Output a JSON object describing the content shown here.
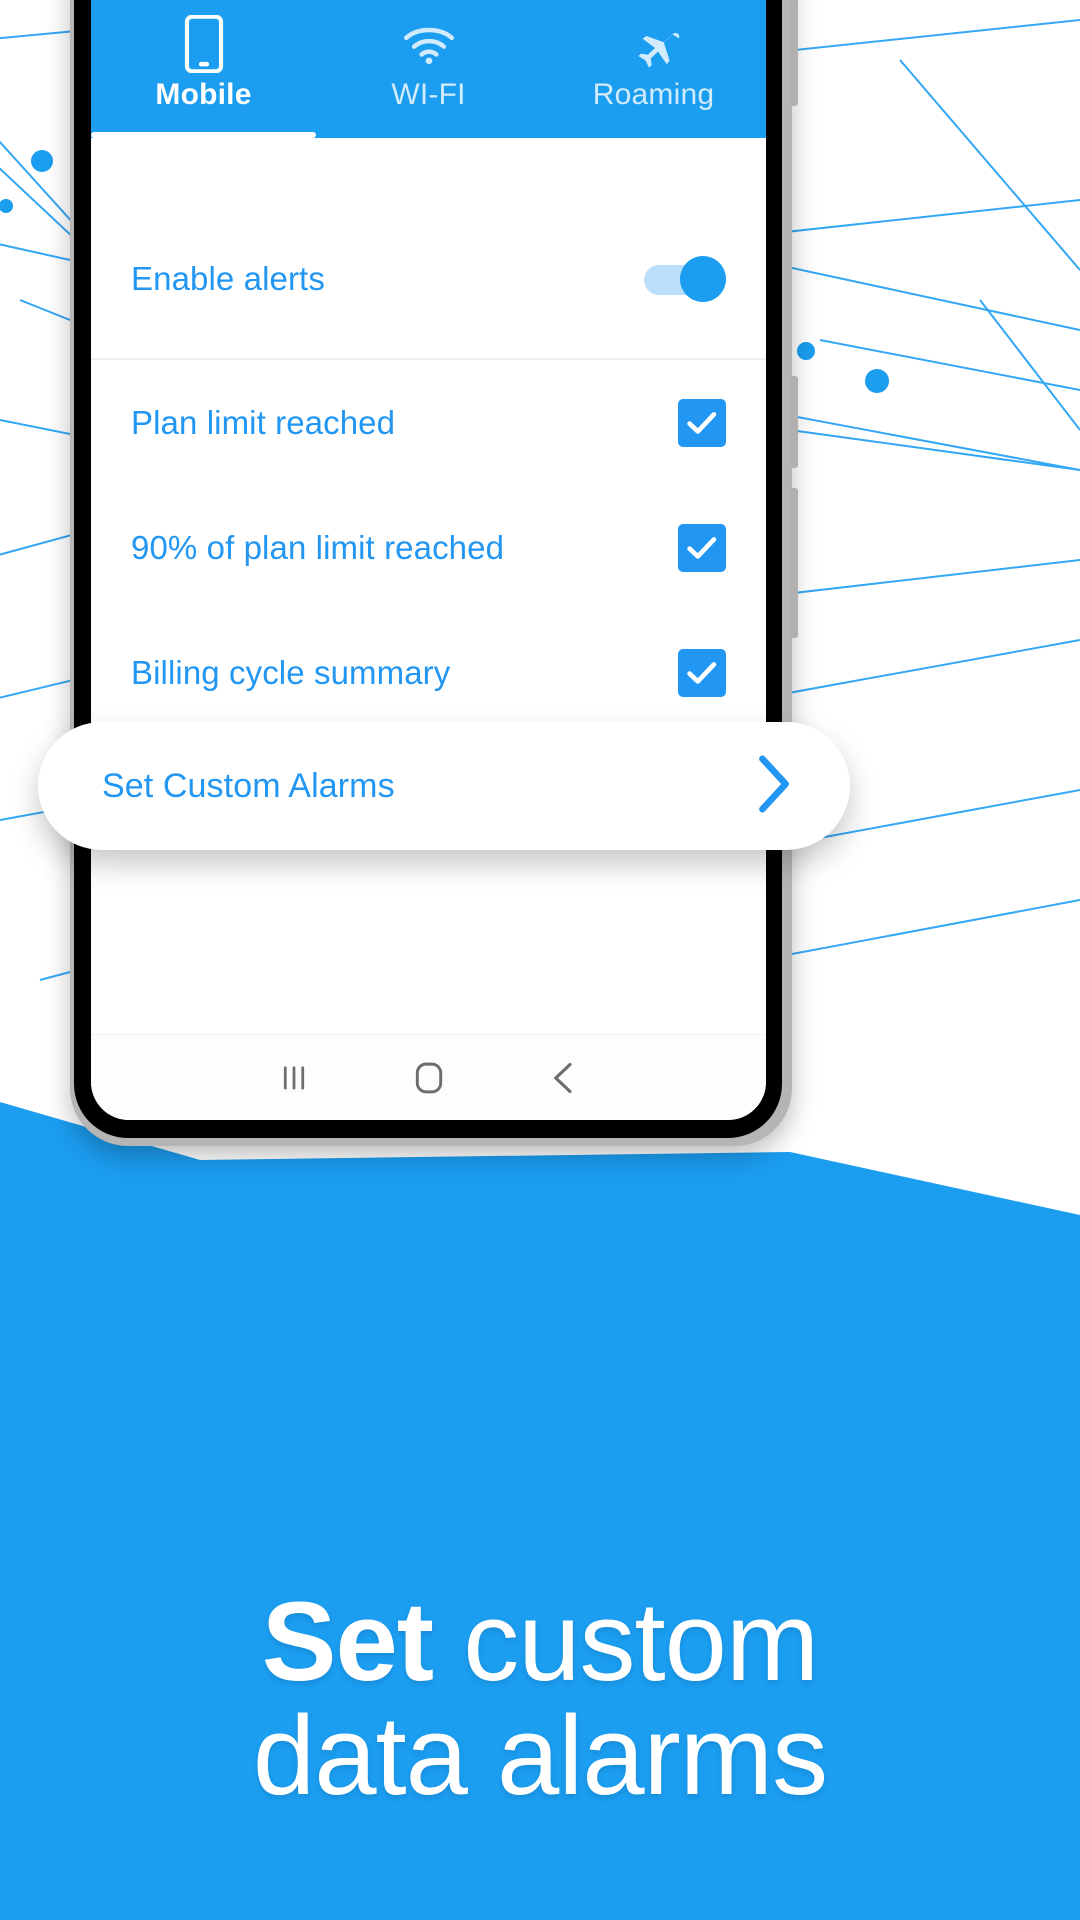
{
  "colors": {
    "brand_blue": "#1b9df0",
    "accent_blue": "#2196f3",
    "toggle_track": "#b9dffb",
    "headline_white": "#ffffff",
    "background_white": "#ffffff",
    "divider": "#f0f0f0"
  },
  "app": {
    "tabs": [
      {
        "label": "Mobile",
        "icon": "mobile-phone-icon",
        "active": true
      },
      {
        "label": "WI-FI",
        "icon": "wifi-icon",
        "active": false
      },
      {
        "label": "Roaming",
        "icon": "airplane-icon",
        "active": false
      }
    ],
    "settings": {
      "enable_alerts": {
        "label": "Enable alerts",
        "control": "toggle-switch",
        "state": "on"
      },
      "alert_options": [
        {
          "label": "Plan limit reached",
          "control": "checkbox",
          "checked": true
        },
        {
          "label": "90% of plan limit reached",
          "control": "checkbox",
          "checked": true
        },
        {
          "label": "Billing cycle summary",
          "control": "checkbox",
          "checked": true
        }
      ]
    },
    "custom_alarms_card": {
      "label": "Set Custom Alarms",
      "chevron": "chevron-right-icon"
    },
    "navbar": {
      "recents": "recents-icon",
      "home": "home-icon",
      "back": "back-icon"
    }
  },
  "promo": {
    "headline_bold": "Set",
    "headline_regular_1": "custom",
    "headline_regular_2": "data alarms"
  }
}
